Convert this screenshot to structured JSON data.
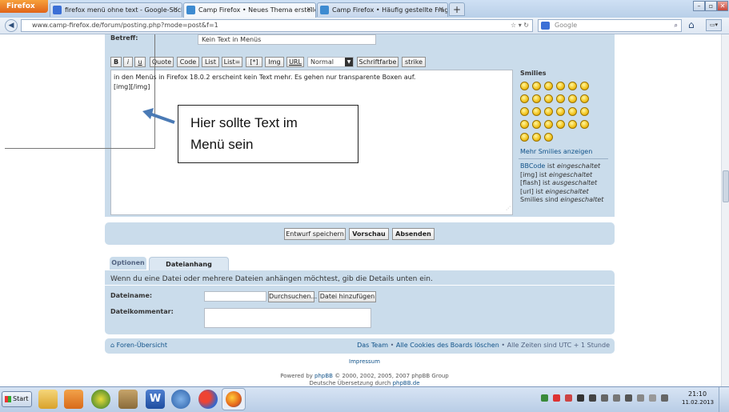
{
  "browser": {
    "menu_button": "Firefox",
    "tabs": [
      {
        "label": "firefox menü ohne text - Google-Suche",
        "favicon_color": "#3b6fd6"
      },
      {
        "label": "Camp Firefox • Neues Thema erstellen",
        "favicon_color": "#3d8bd1"
      },
      {
        "label": "Camp Firefox • Häufig gestellte Fragen",
        "favicon_color": "#3d8bd1"
      }
    ],
    "new_tab": "+",
    "window_buttons": {
      "minimize": "–",
      "restore": "▫",
      "close": "✕"
    },
    "url_host": "www.camp-firefox.de",
    "url_path": "/forum/posting.php?mode=post&f=1",
    "search_placeholder": "Google"
  },
  "post_form": {
    "subject_label": "Betreff:",
    "subject_value": "Kein Text in Menüs",
    "toolbar": [
      "B",
      "i",
      "u",
      "Quote",
      "Code",
      "List",
      "List=",
      "[*]",
      "Img",
      "URL"
    ],
    "font_size_select": "Normal",
    "font_color_button": "Schriftfarbe",
    "strike_button": "strike",
    "message_line1": "in den Menüs in Firefox 18.0.2 erscheint kein Text mehr. Es gehen nur transparente Boxen auf.",
    "message_line2": "[img][/img]"
  },
  "callout": {
    "line1": "Hier sollte Text im",
    "line2": "Menü sein"
  },
  "smilies": {
    "title": "Smilies",
    "more_link": "Mehr Smilies anzeigen",
    "count": 27
  },
  "status_info": [
    {
      "prefix": "BBCode",
      "prefix_is_link": true,
      "text": " ist ",
      "state": "eingeschaltet"
    },
    {
      "prefix": "[img]",
      "prefix_is_link": false,
      "text": " ist ",
      "state": "eingeschaltet"
    },
    {
      "prefix": "[flash]",
      "prefix_is_link": false,
      "text": " ist ",
      "state": "ausgeschaltet"
    },
    {
      "prefix": "[url]",
      "prefix_is_link": false,
      "text": " ist ",
      "state": "eingeschaltet"
    },
    {
      "prefix": "Smilies",
      "prefix_is_link": false,
      "text": " sind ",
      "state": "eingeschaltet"
    }
  ],
  "actions": {
    "save_draft": "Entwurf speichern",
    "preview": "Vorschau",
    "submit": "Absenden"
  },
  "attach": {
    "tab_options": "Optionen",
    "tab_upload": "Dateianhang hochladen",
    "intro": "Wenn du eine Datei oder mehrere Dateien anhängen möchtest, gib die Details unten ein.",
    "filename_label": "Dateiname:",
    "browse_button": "Durchsuchen...",
    "add_file_button": "Datei hinzufügen",
    "comment_label": "Dateikommentar:"
  },
  "footer": {
    "forum_index": "Foren-Übersicht",
    "team": "Das Team",
    "delete_cookies": "Alle Cookies des Boards löschen",
    "timezone": "Alle Zeiten sind UTC + 1 Stunde",
    "sep": "•",
    "impressum": "Impressum",
    "powered_by": "Powered by",
    "phpbb": "phpBB",
    "copyright": "© 2000, 2002, 2005, 2007 phpBB Group",
    "translation": "Deutsche Übersetzung durch",
    "translation_link": "phpBB.de"
  },
  "taskbar": {
    "start": "Start",
    "time": "21:10",
    "date": "11.02.2013"
  }
}
